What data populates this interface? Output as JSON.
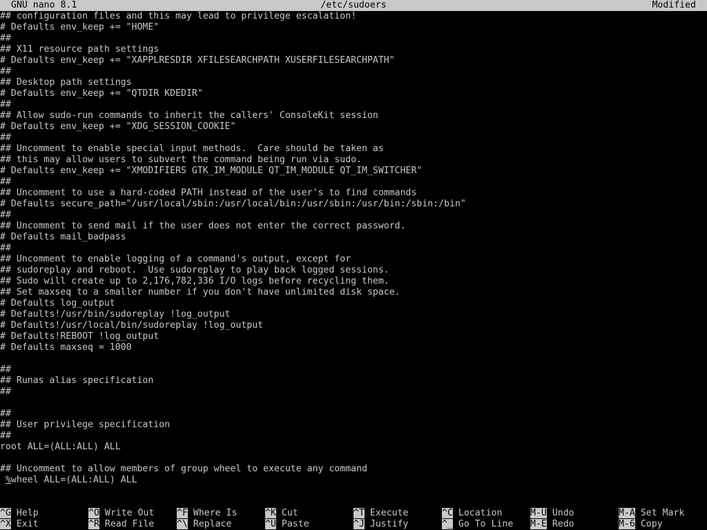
{
  "titlebar": {
    "app": "GNU nano 8.1",
    "file": "/etc/sudoers",
    "state": "Modified"
  },
  "editor": {
    "lines": [
      "## configuration files and this may lead to privilege escalation!",
      "# Defaults env_keep += \"HOME\"",
      "##",
      "## X11 resource path settings",
      "# Defaults env_keep += \"XAPPLRESDIR XFILESEARCHPATH XUSERFILESEARCHPATH\"",
      "##",
      "## Desktop path settings",
      "# Defaults env_keep += \"QTDIR KDEDIR\"",
      "##",
      "## Allow sudo-run commands to inherit the callers' ConsoleKit session",
      "# Defaults env_keep += \"XDG_SESSION_COOKIE\"",
      "##",
      "## Uncomment to enable special input methods.  Care should be taken as",
      "## this may allow users to subvert the command being run via sudo.",
      "# Defaults env_keep += \"XMODIFIERS GTK_IM_MODULE QT_IM_MODULE QT_IM_SWITCHER\"",
      "##",
      "## Uncomment to use a hard-coded PATH instead of the user's to find commands",
      "# Defaults secure_path=\"/usr/local/sbin:/usr/local/bin:/usr/sbin:/usr/bin:/sbin:/bin\"",
      "##",
      "## Uncomment to send mail if the user does not enter the correct password.",
      "# Defaults mail_badpass",
      "##",
      "## Uncomment to enable logging of a command's output, except for",
      "## sudoreplay and reboot.  Use sudoreplay to play back logged sessions.",
      "## Sudo will create up to 2,176,782,336 I/O logs before recycling them.",
      "## Set maxseq to a smaller number if you don't have unlimited disk space.",
      "# Defaults log_output",
      "# Defaults!/usr/bin/sudoreplay !log_output",
      "# Defaults!/usr/local/bin/sudoreplay !log_output",
      "# Defaults!REBOOT !log_output",
      "# Defaults maxseq = 1000",
      "",
      "##",
      "## Runas alias specification",
      "##",
      "",
      "##",
      "## User privilege specification",
      "##",
      "root ALL=(ALL:ALL) ALL",
      "",
      "## Uncomment to allow members of group wheel to execute any command",
      " %wheel ALL=(ALL:ALL) ALL"
    ],
    "cursor_char": "%",
    "cursor_line_rest": "wheel ALL=(ALL:ALL) ALL"
  },
  "shortcuts": {
    "help": {
      "key": "^G",
      "label": "Help"
    },
    "exit": {
      "key": "^X",
      "label": "Exit"
    },
    "writeout": {
      "key": "^O",
      "label": "Write Out"
    },
    "readfile": {
      "key": "^R",
      "label": "Read File"
    },
    "whereis": {
      "key": "^F",
      "label": "Where Is"
    },
    "replace": {
      "key": "^\\",
      "label": "Replace"
    },
    "cut": {
      "key": "^K",
      "label": "Cut"
    },
    "paste": {
      "key": "^U",
      "label": "Paste"
    },
    "execute": {
      "key": "^T",
      "label": "Execute"
    },
    "justify": {
      "key": "^J",
      "label": "Justify"
    },
    "location": {
      "key": "^C",
      "label": "Location"
    },
    "gotoline": {
      "key": "^_",
      "label": "Go To Line"
    },
    "undo": {
      "key": "M-U",
      "label": "Undo"
    },
    "redo": {
      "key": "M-E",
      "label": "Redo"
    },
    "setmark": {
      "key": "M-A",
      "label": "Set Mark"
    },
    "copy": {
      "key": "M-6",
      "label": "Copy"
    }
  }
}
